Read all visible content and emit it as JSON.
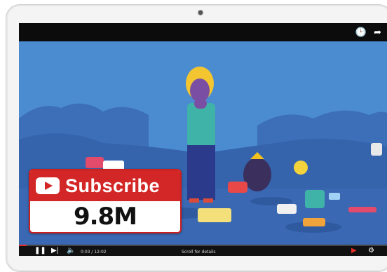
{
  "subscribe_badge": {
    "label": "Subscribe",
    "count": "9.8M"
  },
  "player": {
    "time": "0:03 / 12:02",
    "scroll_hint": "Scroll for details",
    "progress": 0.02,
    "icons": {
      "play_pause": "pause-icon",
      "next": "next-icon",
      "volume": "volume-icon",
      "watch_later": "clock-icon",
      "share": "share-icon",
      "youtube_badge": "youtube-icon",
      "settings": "settings-icon"
    }
  },
  "colors": {
    "video_background": "#4b8cd0",
    "subscribe_red": "#d32626",
    "progress_red": "#e52d27"
  }
}
